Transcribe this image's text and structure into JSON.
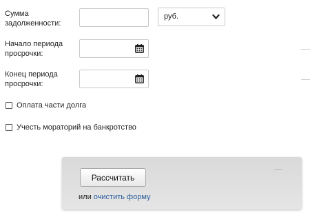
{
  "debt": {
    "label": "Сумма\nзадолженности:",
    "value": "",
    "currency": "руб."
  },
  "period_start": {
    "label": "Начало периода\nпросрочки:",
    "value": ""
  },
  "period_end": {
    "label": "Конец периода\nпросрочки:",
    "value": ""
  },
  "options": {
    "partial_payment": "Оплата части долга",
    "moratorium": "Учесть мораторий на банкротство"
  },
  "actions": {
    "calculate": "Рассчитать",
    "or": "или",
    "clear_form": "очистить форму"
  },
  "icons": {
    "calendar": "calendar-icon",
    "dropdown": "chevron-down-icon"
  },
  "colors": {
    "link": "#2a5d9c",
    "panel": "#dedede",
    "border": "#c9c9c9"
  }
}
